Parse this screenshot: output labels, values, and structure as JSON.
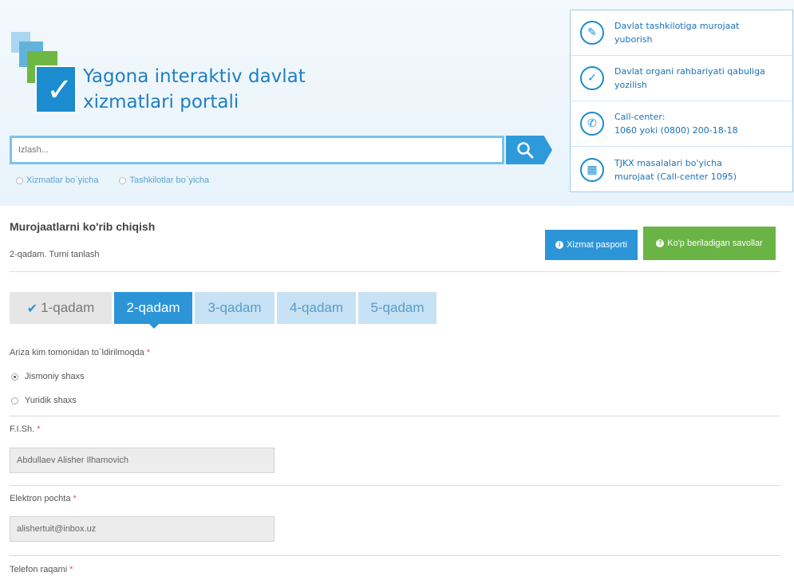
{
  "header": {
    "brand_line1": "Yagona interaktiv davlat",
    "brand_line2": "xizmatlari portali",
    "search": {
      "placeholder": "Izlash..."
    },
    "search_filters": [
      "Xizmatlar bo`yicha",
      "Tashkilotlar bo`yicha"
    ],
    "links": [
      {
        "line1": "Davlat tashkilotiga murojaat",
        "line2": "yuborish",
        "icon": "edit-icon"
      },
      {
        "line1": "Davlat organi rahbariyati qabuliga",
        "line2": "yozilish",
        "icon": "check-circle-icon"
      },
      {
        "line1": "Call-center:",
        "line2": "1060 yoki (0800) 200-18-18",
        "icon": "phone-icon"
      },
      {
        "line1": "TJKX masalalari bo'yicha",
        "line2": "murojaat (Call-center 1095)",
        "icon": "building-icon"
      }
    ]
  },
  "page": {
    "title": "Murojaatlarni ko'rib chiqish",
    "subtitle": "2-qadam. Turni tanlash",
    "buttons": {
      "passport": "Xizmat pasporti",
      "faq": "Ko'p beriladigan savollar"
    }
  },
  "steps": [
    "1-qadam",
    "2-qadam",
    "3-qadam",
    "4-qadam",
    "5-qadam"
  ],
  "form": {
    "applicant_question": "Ariza kim tomonidan to`ldirilmoqda",
    "applicant_options": [
      "Jismoniy shaxs",
      "Yuridik shaxs"
    ],
    "selected_option": "Jismoniy shaxs",
    "fio_label": "F.I.Sh.",
    "fio_value": "Abdullaev Alisher Ilhamovich",
    "email_label": "Elektron pochta",
    "email_value": "alishertuit@inbox.uz",
    "phone_label": "Telefon raqami",
    "required_mark": "*"
  },
  "colors": {
    "primary": "#2c95d8",
    "success": "#6ab445",
    "step_inactive": "#c7e2f4"
  }
}
